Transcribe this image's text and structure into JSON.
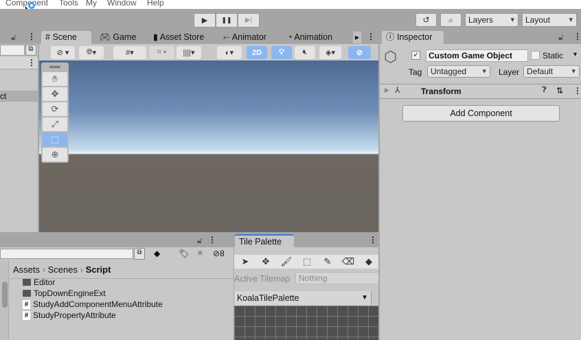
{
  "menu": [
    "Component",
    "Tools",
    "My",
    "Window",
    "Help"
  ],
  "toolbar": {
    "play": "▶",
    "pause": "❚❚",
    "step": "▶|",
    "layers": "Layers",
    "layout": "Layout"
  },
  "hierarchy": {
    "selected_item": "ct"
  },
  "scene": {
    "tabs": [
      "Scene",
      "Game",
      "Asset Store",
      "Animator",
      "Animation"
    ],
    "mode_2d": "2D"
  },
  "inspector": {
    "tab": "Inspector",
    "object_name": "Custom Game Object",
    "static_label": "Static",
    "tag_label": "Tag",
    "tag_value": "Untagged",
    "layer_label": "Layer",
    "layer_value": "Default",
    "component": "Transform",
    "add_component": "Add Component"
  },
  "project": {
    "breadcrumb": [
      "Assets",
      "Scenes",
      "Script"
    ],
    "hidden_count": "8",
    "items": [
      {
        "name": "Editor",
        "type": "folder"
      },
      {
        "name": "TopDownEngineExt",
        "type": "folder"
      },
      {
        "name": "StudyAddComponentMenuAttribute",
        "type": "script"
      },
      {
        "name": "StudyPropertyAttribute",
        "type": "script"
      }
    ]
  },
  "tile_palette": {
    "tab": "Tile Palette",
    "active_tilemap_label": "Active Tilemap",
    "active_tilemap_value": "Nothing",
    "palette": "KoalaTilePalette"
  }
}
